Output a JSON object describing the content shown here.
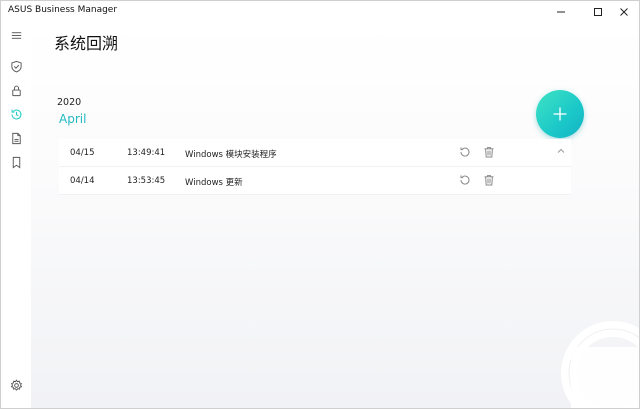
{
  "window": {
    "title": "ASUS Business Manager",
    "controls": {
      "minimize": "minimize",
      "maximize": "maximize",
      "close": "close"
    }
  },
  "sidebar": {
    "items": [
      {
        "icon": "menu-icon",
        "active": false
      },
      {
        "icon": "shield-check-icon",
        "active": false
      },
      {
        "icon": "lock-icon",
        "active": false
      },
      {
        "icon": "history-icon",
        "active": true
      },
      {
        "icon": "document-icon",
        "active": false
      },
      {
        "icon": "bookmark-icon",
        "active": false
      }
    ],
    "bottom": {
      "icon": "gear-icon"
    }
  },
  "page": {
    "title": "系统回溯",
    "year": "2020",
    "month": "April"
  },
  "records": [
    {
      "date": "04/15",
      "time": "13:49:41",
      "description": "Windows 模块安装程序"
    },
    {
      "date": "04/14",
      "time": "13:53:45",
      "description": "Windows 更新"
    }
  ],
  "colors": {
    "accent": "#22c9c9",
    "fab_start": "#3ee3c4",
    "fab_end": "#14b2c4"
  }
}
